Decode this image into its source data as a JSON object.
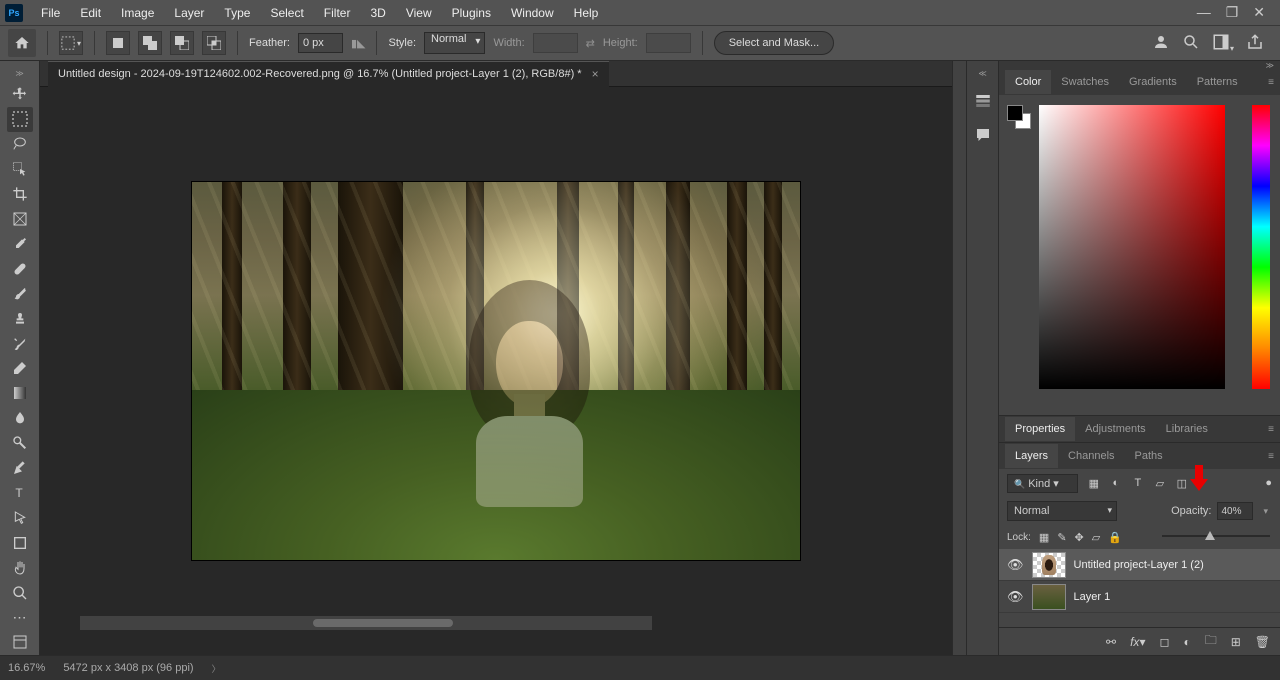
{
  "menu": {
    "items": [
      "File",
      "Edit",
      "Image",
      "Layer",
      "Type",
      "Select",
      "Filter",
      "3D",
      "View",
      "Plugins",
      "Window",
      "Help"
    ]
  },
  "options": {
    "feather_label": "Feather:",
    "feather_value": "0 px",
    "style_label": "Style:",
    "style_value": "Normal",
    "width_label": "Width:",
    "height_label": "Height:",
    "select_mask": "Select and Mask..."
  },
  "document": {
    "tab_title": "Untitled design - 2024-09-19T124602.002-Recovered.png @ 16.7% (Untitled project-Layer 1 (2), RGB/8#) *"
  },
  "panels": {
    "color_tabs": [
      "Color",
      "Swatches",
      "Gradients",
      "Patterns"
    ],
    "props_tabs": [
      "Properties",
      "Adjustments",
      "Libraries"
    ],
    "layer_tabs": [
      "Layers",
      "Channels",
      "Paths"
    ]
  },
  "layers": {
    "filter_kind": "Kind",
    "blend_mode": "Normal",
    "opacity_label": "Opacity:",
    "opacity_value": "40%",
    "lock_label": "Lock:",
    "items": [
      {
        "name": "Untitled project-Layer 1 (2)",
        "selected": true,
        "thumb": "portrait"
      },
      {
        "name": "Layer 1",
        "selected": false,
        "thumb": "forest"
      }
    ]
  },
  "status": {
    "zoom": "16.67%",
    "dims": "5472 px x 3408 px (96 ppi)"
  }
}
